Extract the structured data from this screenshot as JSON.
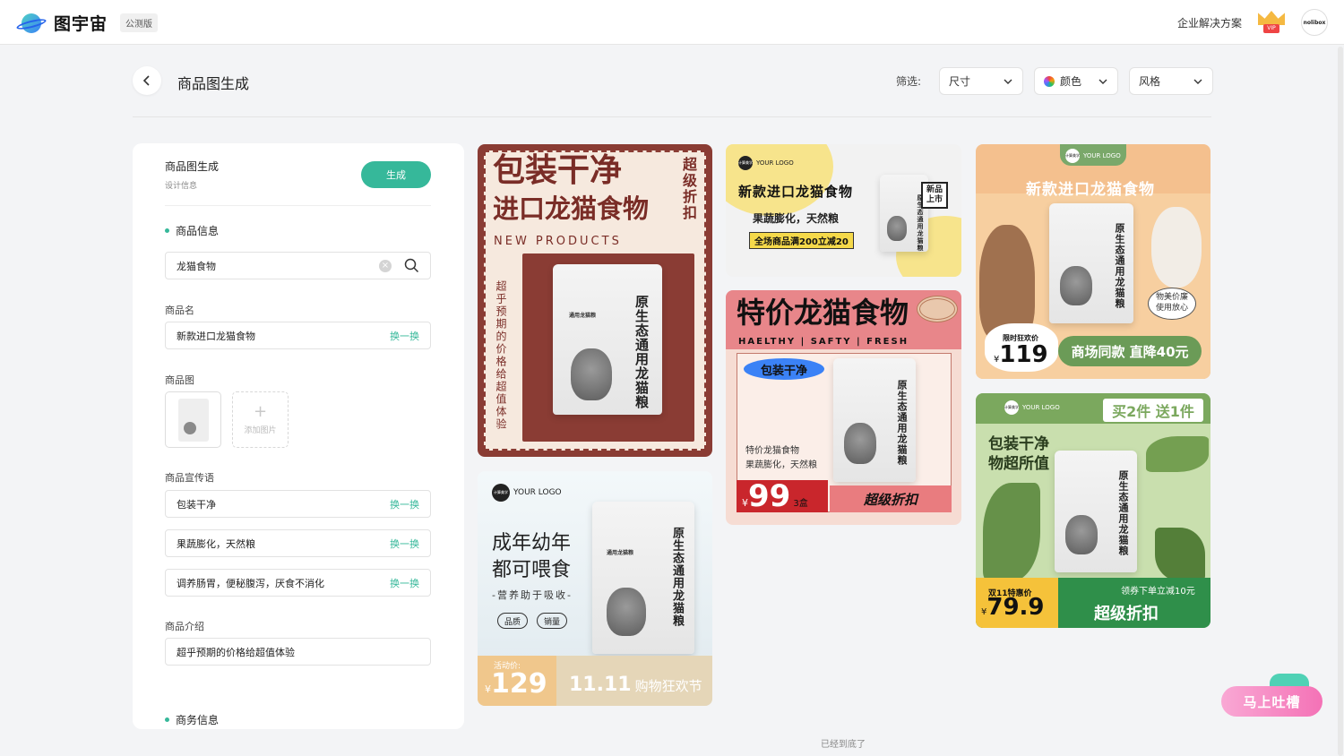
{
  "app": {
    "name": "图宇宙",
    "badge": "公测版"
  },
  "topbar": {
    "enterprise_link": "企业解决方案",
    "vip_label": "VIP",
    "avatar_text": "nolibox"
  },
  "header": {
    "title": "商品图生成"
  },
  "filters": {
    "label": "筛选:",
    "size": "尺寸",
    "color": "颜色",
    "style": "风格"
  },
  "panel": {
    "title": "商品图生成",
    "subtitle": "设计信息",
    "generate_button": "生成",
    "product_section": "商品信息",
    "search_value": "龙猫食物",
    "name_label": "商品名",
    "name_value": "新款进口龙猫食物",
    "swap_label": "换一换",
    "image_label": "商品图",
    "add_image": "添加图片",
    "slogan_label": "商品宣传语",
    "slogans": [
      "包装干净",
      "果蔬膨化，天然粮",
      "调养肠胃，便秘腹泻，厌食不消化"
    ],
    "intro_label": "商品介绍",
    "intro_value": "超乎预期的价格给超值体验",
    "business_section": "商务信息"
  },
  "bag": {
    "vertical_name": "原生态通用龙猫粮",
    "title": "通用龙猫粮"
  },
  "posters": {
    "p1": {
      "line1": "包装干净",
      "line2": "进口龙猫食物",
      "side": "超级折扣",
      "en": "NEW PRODUCTS",
      "desc": "超乎预期的价格给超值体验"
    },
    "p2": {
      "logo": "YOUR LOGO",
      "logo_chip": "计算美学",
      "title": "新款进口龙猫食物",
      "sub": "果蔬膨化，天然粮",
      "promo": "全场商品满200立减20",
      "tag_line1": "新品",
      "tag_line2": "上市"
    },
    "p3": {
      "title": "特价龙猫食物",
      "en": "HAELTHY | SAFTY | FRESH",
      "pill": "包装干净",
      "line1": "特价龙猫食物",
      "line2": "果蔬膨化，天然粮",
      "price": "99",
      "unit": "3盒",
      "discount": "超级折扣",
      "currency": "¥"
    },
    "p4": {
      "logo": "YOUR LOGO",
      "logo_chip": "计算美学",
      "title": "新款进口龙猫食物",
      "bubble_line1": "物美价廉",
      "bubble_line2": "使用放心",
      "price_label": "限时狂欢价",
      "price": "119",
      "currency": "¥",
      "cta": "商场同款 直降40元"
    },
    "p5": {
      "logo": "YOUR LOGO",
      "logo_chip": "计算美学",
      "line1": "成年幼年",
      "line2": "都可喂食",
      "sub": "-营养助于吸收-",
      "tag1": "品质",
      "tag2": "销量",
      "price_label": "活动价:",
      "price": "129",
      "currency": "¥",
      "event_num": "11.11",
      "event_text": "购物狂欢节"
    },
    "p6": {
      "logo": "YOUR LOGO",
      "logo_chip": "计算美学",
      "promo": "买2件 送1件",
      "line1": "包装干净",
      "line2": "物超所值",
      "price_label": "双11特惠价",
      "price": "79.9",
      "currency": "¥",
      "coupon": "领券下单立减10元",
      "discount": "超级折扣"
    }
  },
  "footer": {
    "end_note": "已经到底了",
    "feedback": "马上吐槽"
  }
}
